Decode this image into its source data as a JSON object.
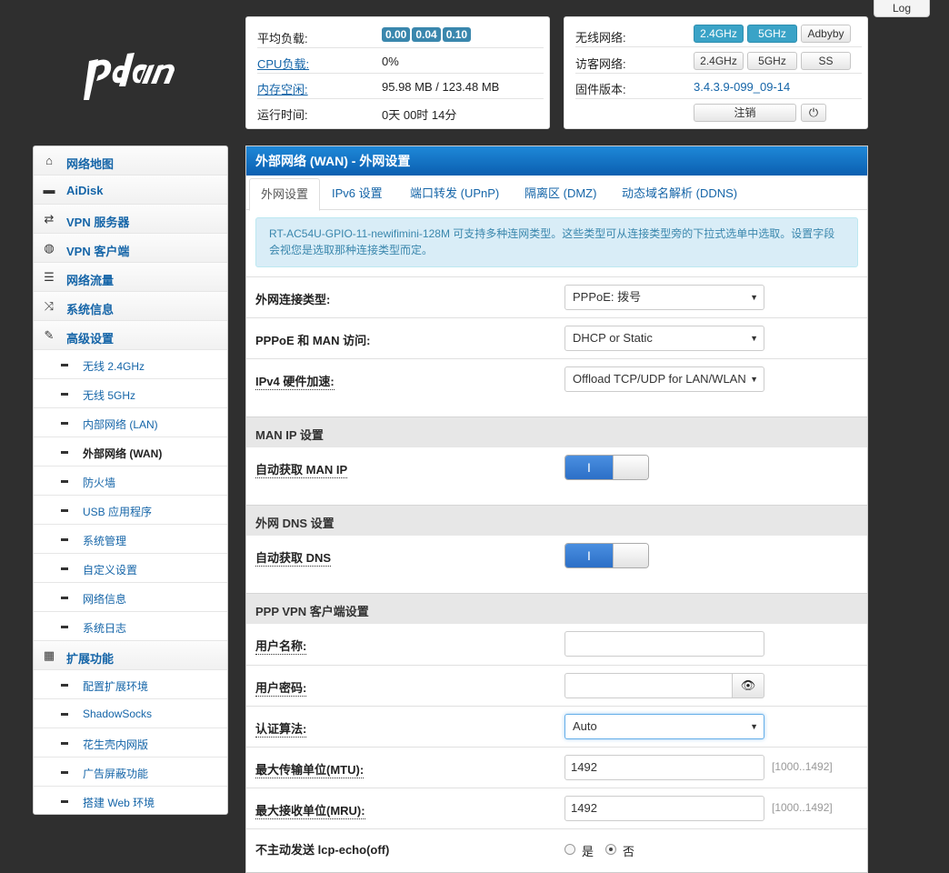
{
  "top": {
    "log_label": "Log"
  },
  "logo": {
    "text": "pdan"
  },
  "status": {
    "load_label": "平均负载:",
    "load_values": [
      "0.00",
      "0.04",
      "0.10"
    ],
    "cpu_label": "CPU负载:",
    "cpu_value": "0%",
    "mem_label": "内存空闲:",
    "mem_value": "95.98 MB / 123.48 MB",
    "uptime_label": "运行时间:",
    "uptime_value": "0天 00时 14分"
  },
  "wireless": {
    "wifi_label": "无线网络:",
    "wifi_buttons": [
      "2.4GHz",
      "5GHz",
      "Adbyby"
    ],
    "guest_label": "访客网络:",
    "guest_buttons": [
      "2.4GHz",
      "5GHz",
      "SS"
    ],
    "fw_label": "固件版本:",
    "fw_value": "3.4.3.9-099_09-14",
    "logout_label": "注销"
  },
  "sidebar": {
    "items": [
      {
        "label": "网络地图",
        "icon": "home-icon"
      },
      {
        "label": "AiDisk",
        "icon": "disk-icon"
      },
      {
        "label": "VPN 服务器",
        "icon": "retweet-icon"
      },
      {
        "label": "VPN 客户端",
        "icon": "globe-icon"
      },
      {
        "label": "网络流量",
        "icon": "list-icon"
      },
      {
        "label": "系统信息",
        "icon": "random-icon"
      },
      {
        "label": "高级设置",
        "icon": "wrench-icon"
      }
    ],
    "advanced": [
      "无线 2.4GHz",
      "无线 5GHz",
      "内部网络 (LAN)",
      "外部网络 (WAN)",
      "防火墙",
      "USB 应用程序",
      "系统管理",
      "自定义设置",
      "网络信息",
      "系统日志"
    ],
    "ext_label": "扩展功能",
    "ext_icon": "grid-icon",
    "extensions": [
      "配置扩展环境",
      "ShadowSocks",
      "花生壳内网版",
      "广告屏蔽功能",
      "搭建 Web 环境"
    ]
  },
  "main": {
    "title": "外部网络 (WAN) - 外网设置",
    "tabs": [
      "外网设置",
      "IPv6 设置",
      "端口转发 (UPnP)",
      "隔离区 (DMZ)",
      "动态域名解析 (DDNS)"
    ],
    "alert": "RT-AC54U-GPIO-11-newifimini-128M 可支持多种连网类型。这些类型可从连接类型旁的下拉式选单中选取。设置字段会视您是选取那种连接类型而定。",
    "wan_type_label": "外网连接类型:",
    "wan_type_value": "PPPoE: 拨号",
    "man_label": "PPPoE 和 MAN 访问:",
    "man_value": "DHCP or Static",
    "hw_label": "IPv4 硬件加速:",
    "hw_value": "Offload TCP/UDP for LAN/WLAN",
    "section_man": "MAN IP 设置",
    "auto_ip_label": "自动获取 MAN IP",
    "section_dns": "外网 DNS 设置",
    "auto_dns_label": "自动获取 DNS",
    "toggle_on": "I",
    "section_ppp": "PPP VPN 客户端设置",
    "user_label": "用户名称:",
    "user_value": "",
    "pass_label": "用户密码:",
    "pass_value": "",
    "auth_label": "认证算法:",
    "auth_value": "Auto",
    "mtu_label": "最大传输单位(MTU):",
    "mtu_value": "1492",
    "mtu_hint": "[1000..1492]",
    "mru_label": "最大接收单位(MRU):",
    "mru_value": "1492",
    "mru_hint": "[1000..1492]",
    "lcp_label": "不主动发送 lcp-echo(off)",
    "lcp_yes": "是",
    "lcp_no": "否"
  }
}
